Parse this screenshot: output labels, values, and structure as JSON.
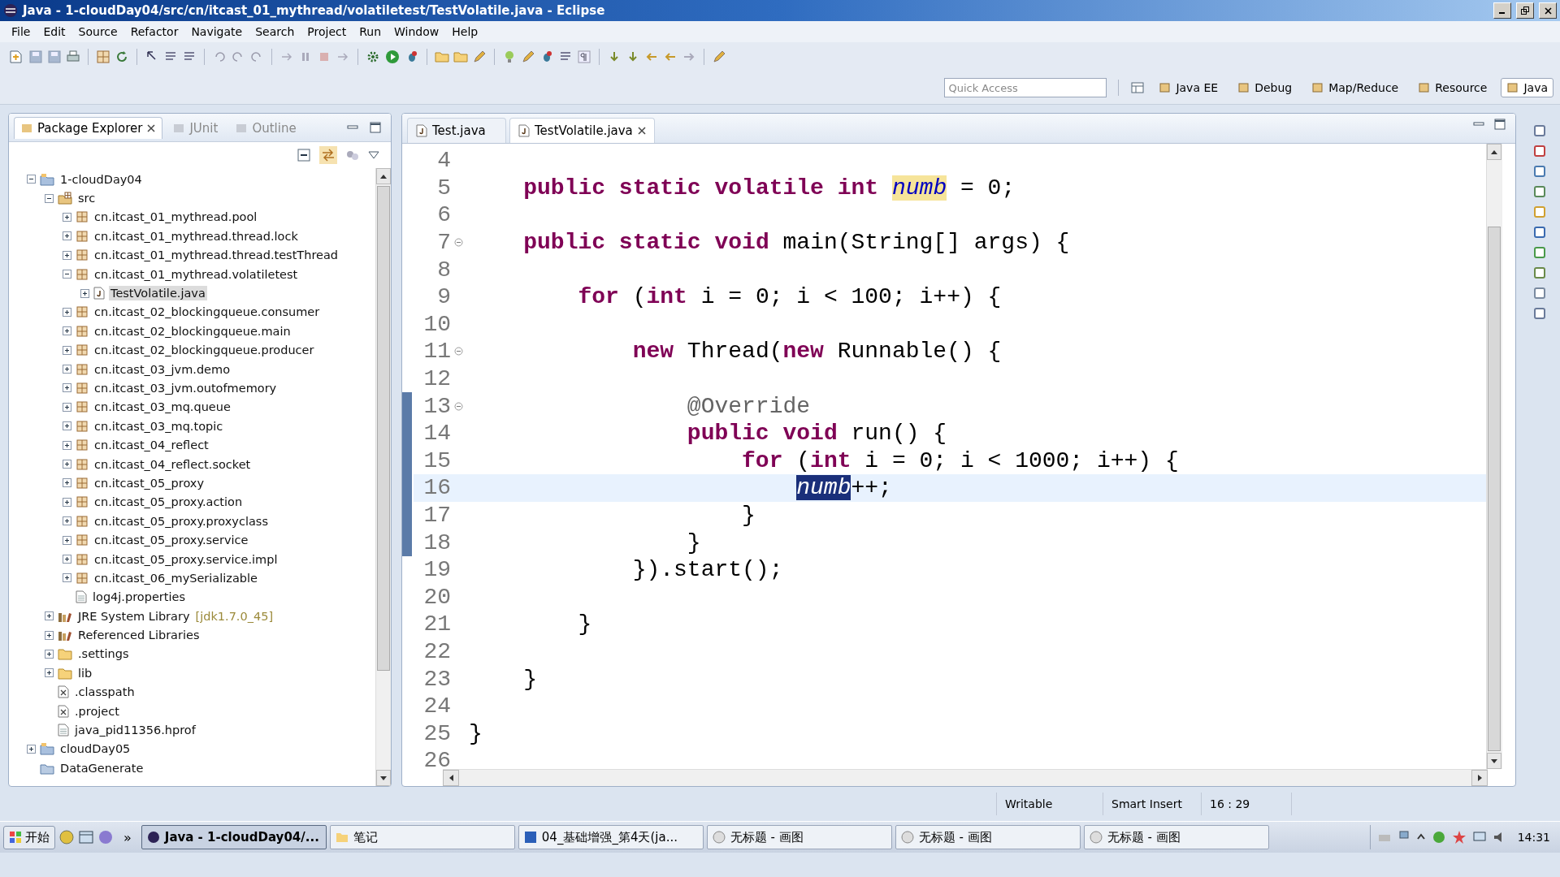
{
  "window": {
    "title": "Java - 1-cloudDay04/src/cn/itcast_01_mythread/volatiletest/TestVolatile.java - Eclipse"
  },
  "menu": [
    "File",
    "Edit",
    "Source",
    "Refactor",
    "Navigate",
    "Search",
    "Project",
    "Run",
    "Window",
    "Help"
  ],
  "quick_access": {
    "placeholder": "Quick Access"
  },
  "perspectives": [
    {
      "label": "Java EE",
      "selected": false
    },
    {
      "label": "Debug",
      "selected": false
    },
    {
      "label": "Map/Reduce",
      "selected": false
    },
    {
      "label": "Resource",
      "selected": false
    },
    {
      "label": "Java",
      "selected": true
    }
  ],
  "explorer": {
    "tabs": [
      {
        "label": "Package Explorer",
        "selected": true
      },
      {
        "label": "JUnit",
        "selected": false
      },
      {
        "label": "Outline",
        "selected": false
      }
    ],
    "tree": [
      {
        "label": "1-cloudDay04",
        "kind": "project",
        "expanded": true,
        "selected": false,
        "children": [
          {
            "label": "src",
            "kind": "source",
            "expanded": true,
            "selected": false,
            "children": [
              {
                "label": "cn.itcast_01_mythread.pool",
                "kind": "package",
                "expanded": false,
                "selected": false
              },
              {
                "label": "cn.itcast_01_mythread.thread.lock",
                "kind": "package",
                "expanded": false,
                "selected": false
              },
              {
                "label": "cn.itcast_01_mythread.thread.testThread",
                "kind": "package",
                "expanded": false,
                "selected": false
              },
              {
                "label": "cn.itcast_01_mythread.volatiletest",
                "kind": "package",
                "expanded": true,
                "selected": false,
                "children": [
                  {
                    "label": "TestVolatile.java",
                    "kind": "java",
                    "expanded": false,
                    "selected": true
                  }
                ]
              },
              {
                "label": "cn.itcast_02_blockingqueue.consumer",
                "kind": "package",
                "expanded": false,
                "selected": false
              },
              {
                "label": "cn.itcast_02_blockingqueue.main",
                "kind": "package",
                "expanded": false,
                "selected": false
              },
              {
                "label": "cn.itcast_02_blockingqueue.producer",
                "kind": "package",
                "expanded": false,
                "selected": false
              },
              {
                "label": "cn.itcast_03_jvm.demo",
                "kind": "package",
                "expanded": false,
                "selected": false
              },
              {
                "label": "cn.itcast_03_jvm.outofmemory",
                "kind": "package",
                "expanded": false,
                "selected": false
              },
              {
                "label": "cn.itcast_03_mq.queue",
                "kind": "package",
                "expanded": false,
                "selected": false
              },
              {
                "label": "cn.itcast_03_mq.topic",
                "kind": "package",
                "expanded": false,
                "selected": false
              },
              {
                "label": "cn.itcast_04_reflect",
                "kind": "package",
                "expanded": false,
                "selected": false
              },
              {
                "label": "cn.itcast_04_reflect.socket",
                "kind": "package",
                "expanded": false,
                "selected": false
              },
              {
                "label": "cn.itcast_05_proxy",
                "kind": "package",
                "expanded": false,
                "selected": false
              },
              {
                "label": "cn.itcast_05_proxy.action",
                "kind": "package",
                "expanded": false,
                "selected": false
              },
              {
                "label": "cn.itcast_05_proxy.proxyclass",
                "kind": "package",
                "expanded": false,
                "selected": false
              },
              {
                "label": "cn.itcast_05_proxy.service",
                "kind": "package",
                "expanded": false,
                "selected": false
              },
              {
                "label": "cn.itcast_05_proxy.service.impl",
                "kind": "package",
                "expanded": false,
                "selected": false
              },
              {
                "label": "cn.itcast_06_mySerializable",
                "kind": "package",
                "expanded": false,
                "selected": false
              },
              {
                "label": "log4j.properties",
                "kind": "file",
                "selected": false
              }
            ]
          },
          {
            "label": "JRE System Library",
            "detail": "[jdk1.7.0_45]",
            "kind": "library",
            "expanded": false,
            "selected": false
          },
          {
            "label": "Referenced Libraries",
            "kind": "library",
            "expanded": false,
            "selected": false
          },
          {
            "label": ".settings",
            "kind": "folder",
            "expanded": false,
            "selected": false
          },
          {
            "label": "lib",
            "kind": "folder",
            "expanded": false,
            "selected": false
          },
          {
            "label": ".classpath",
            "kind": "xml",
            "selected": false
          },
          {
            "label": ".project",
            "kind": "xml",
            "selected": false
          },
          {
            "label": "java_pid11356.hprof",
            "kind": "file",
            "selected": false
          }
        ]
      },
      {
        "label": "cloudDay05",
        "kind": "project",
        "expanded": false,
        "selected": false
      },
      {
        "label": "DataGenerate",
        "kind": "closed-project",
        "selected": false
      }
    ]
  },
  "editor": {
    "tabs": [
      {
        "label": "Test.java",
        "selected": false
      },
      {
        "label": "TestVolatile.java",
        "selected": true
      }
    ],
    "lines": [
      {
        "number": "4",
        "current": false,
        "in_range": false
      },
      {
        "number": "5",
        "current": false,
        "in_range": false,
        "tokens": [
          {
            "kind": "keyword",
            "text": "    public "
          },
          {
            "kind": "keyword",
            "text": "static "
          },
          {
            "kind": "keyword",
            "text": "volatile "
          },
          {
            "kind": "keyword",
            "text": "int "
          },
          {
            "kind": "field",
            "text": "numb",
            "selected": false,
            "marked": true
          },
          {
            "kind": "text",
            "text": " = 0;"
          }
        ]
      },
      {
        "number": "6",
        "current": false,
        "in_range": false
      },
      {
        "number": "7",
        "current": false,
        "in_range": false,
        "foldable": true,
        "tokens": [
          {
            "kind": "keyword",
            "text": "    public "
          },
          {
            "kind": "keyword",
            "text": "static "
          },
          {
            "kind": "keyword",
            "text": "void"
          },
          {
            "kind": "text",
            "text": " main(String[] args) {"
          }
        ]
      },
      {
        "number": "8",
        "current": false,
        "in_range": false
      },
      {
        "number": "9",
        "current": false,
        "in_range": false,
        "tokens": [
          {
            "kind": "keyword",
            "text": "        for"
          },
          {
            "kind": "text",
            "text": " ("
          },
          {
            "kind": "keyword",
            "text": "int"
          },
          {
            "kind": "text",
            "text": " i = 0; i < 100; i++) {"
          }
        ]
      },
      {
        "number": "10",
        "current": false,
        "in_range": false
      },
      {
        "number": "11",
        "current": false,
        "in_range": false,
        "foldable": true,
        "tokens": [
          {
            "kind": "keyword",
            "text": "            new"
          },
          {
            "kind": "text",
            "text": " Thread("
          },
          {
            "kind": "keyword",
            "text": "new"
          },
          {
            "kind": "text",
            "text": " Runnable() {"
          }
        ]
      },
      {
        "number": "12",
        "current": false,
        "in_range": false
      },
      {
        "number": "13",
        "current": false,
        "in_range": true,
        "foldable": true,
        "tokens": [
          {
            "kind": "annotation",
            "text": "                @Override"
          }
        ]
      },
      {
        "number": "14",
        "current": false,
        "in_range": true,
        "tokens": [
          {
            "kind": "keyword",
            "text": "                public "
          },
          {
            "kind": "keyword",
            "text": "void"
          },
          {
            "kind": "text",
            "text": " run() {"
          }
        ]
      },
      {
        "number": "15",
        "current": false,
        "in_range": true,
        "tokens": [
          {
            "kind": "keyword",
            "text": "                    for"
          },
          {
            "kind": "text",
            "text": " ("
          },
          {
            "kind": "keyword",
            "text": "int"
          },
          {
            "kind": "text",
            "text": " i = 0; i < 1000; i++) {"
          }
        ]
      },
      {
        "number": "16",
        "current": true,
        "in_range": true,
        "tokens": [
          {
            "kind": "field",
            "text": "                        numb",
            "selected": true
          },
          {
            "kind": "text",
            "text": "++;"
          }
        ]
      },
      {
        "number": "17",
        "current": false,
        "in_range": true,
        "tokens": [
          {
            "kind": "text",
            "text": "                    }"
          }
        ]
      },
      {
        "number": "18",
        "current": false,
        "in_range": true,
        "tokens": [
          {
            "kind": "text",
            "text": "                }"
          }
        ]
      },
      {
        "number": "19",
        "current": false,
        "in_range": false,
        "tokens": [
          {
            "kind": "text",
            "text": "            }).start();"
          }
        ]
      },
      {
        "number": "20",
        "current": false,
        "in_range": false
      },
      {
        "number": "21",
        "current": false,
        "in_range": false,
        "tokens": [
          {
            "kind": "text",
            "text": "        }"
          }
        ]
      },
      {
        "number": "22",
        "current": false,
        "in_range": false
      },
      {
        "number": "23",
        "current": false,
        "in_range": false,
        "tokens": [
          {
            "kind": "text",
            "text": "    }"
          }
        ]
      },
      {
        "number": "24",
        "current": false,
        "in_range": false
      },
      {
        "number": "25",
        "current": false,
        "in_range": false,
        "tokens": [
          {
            "kind": "text",
            "text": "}"
          }
        ]
      },
      {
        "number": "26",
        "current": false,
        "in_range": false
      }
    ]
  },
  "status_bar": [
    "Writable",
    "Smart Insert",
    "16 : 29"
  ],
  "taskbar": {
    "start": "开始",
    "tasks": [
      {
        "label": "Java - 1-cloudDay04/...",
        "kind": "eclipse",
        "selected": true
      },
      {
        "label": "笔记",
        "kind": "folder",
        "selected": false
      },
      {
        "label": "04_基础增强_第4天(ja...",
        "kind": "word",
        "selected": false
      },
      {
        "label": "无标题 - 画图",
        "kind": "paint",
        "selected": false
      },
      {
        "label": "无标题 - 画图",
        "kind": "paint",
        "selected": false
      },
      {
        "label": "无标题 - 画图",
        "kind": "paint",
        "selected": false
      }
    ],
    "overflow": "»",
    "clock": "14:31"
  }
}
